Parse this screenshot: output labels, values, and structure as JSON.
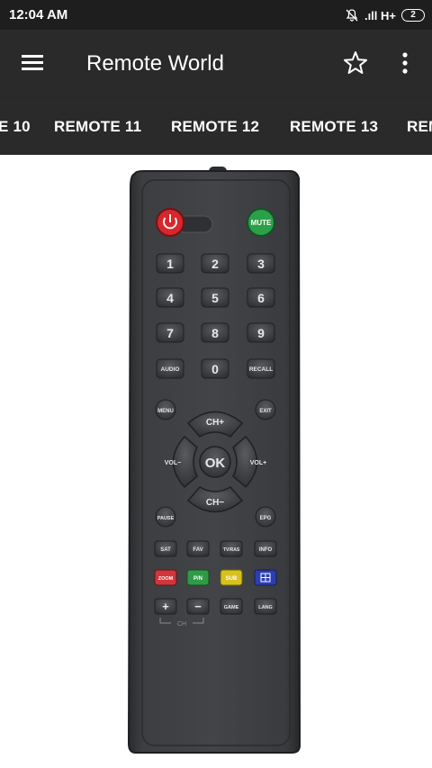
{
  "status": {
    "time": "12:04 AM",
    "network": ".ıll H+",
    "battery": "2"
  },
  "app_bar": {
    "title": "Remote World",
    "icons": [
      "menu-icon",
      "star-icon",
      "more-vert-icon"
    ]
  },
  "tabs": [
    "E 10",
    "REMOTE 11",
    "REMOTE 12",
    "REMOTE 13",
    "REM"
  ],
  "remote": {
    "image_alt": "TV remote control",
    "colors": {
      "power": "#d8262b",
      "mute": "#2aa048",
      "zoom": "#d2353a",
      "pn": "#2f9a47",
      "sub": "#d6c21e",
      "grid": "#2c3eb0"
    },
    "buttons": {
      "mute": "MUTE",
      "digits": [
        "1",
        "2",
        "3",
        "4",
        "5",
        "6",
        "7",
        "8",
        "9",
        "0"
      ],
      "audio": "AUDIO",
      "recall": "RECALL",
      "menu": "MENU",
      "exit": "EXIT",
      "ch_up": "CH+",
      "ch_down": "CH−",
      "vol_down": "VOL−",
      "vol_up": "VOL+",
      "ok": "OK",
      "pause": "PAUSE",
      "epg": "EPG",
      "sat": "SAT",
      "fav": "FAV",
      "tv_ras": "TV/RAS",
      "info": "INFO",
      "zoom": "ZOOM",
      "pn": "P/N",
      "sub": "SUB",
      "plus": "+",
      "minus": "−",
      "ch_label": "CH",
      "game": "GAME",
      "lang": "LANG"
    }
  }
}
